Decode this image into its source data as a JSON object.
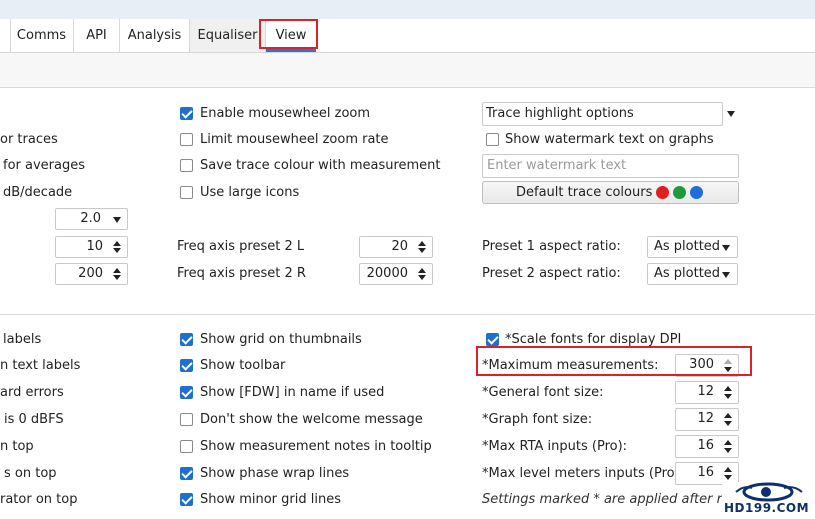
{
  "tabs": [
    {
      "label": "Comms"
    },
    {
      "label": "API"
    },
    {
      "label": "Analysis"
    },
    {
      "label": "Equaliser"
    },
    {
      "label": "View"
    }
  ],
  "left_labels": [
    "or traces",
    "for averages",
    "dB/decade",
    "labels",
    "n text labels",
    "ard errors",
    "is 0 dBFS",
    "n top",
    "s on top",
    "rator on top"
  ],
  "middle_checkboxes_top": [
    {
      "label": "Enable mousewheel zoom",
      "checked": true
    },
    {
      "label": "Limit mousewheel zoom rate",
      "checked": false
    },
    {
      "label": "Save trace colour with measurement",
      "checked": false
    },
    {
      "label": "Use large icons",
      "checked": false
    }
  ],
  "left_controls": {
    "line_width_value": "2.0",
    "spin1_value": "10",
    "spin2_value": "200"
  },
  "freq_presets": [
    {
      "label": "Freq axis preset 2 L",
      "value": "20"
    },
    {
      "label": "Freq axis preset 2 R",
      "value": "20000"
    }
  ],
  "right_top": {
    "trace_highlight_label": "Trace highlight options",
    "watermark_checkbox": {
      "label": "Show watermark text on graphs",
      "checked": false
    },
    "watermark_placeholder": "Enter watermark text",
    "default_colours_label": "Default trace colours",
    "colour_dots": [
      "#e02020",
      "#1f9a3a",
      "#1e6fd9"
    ],
    "aspect_rows": [
      {
        "label": "Preset 1 aspect ratio:",
        "value": "As plotted"
      },
      {
        "label": "Preset 2 aspect ratio:",
        "value": "As plotted"
      }
    ]
  },
  "middle_checkboxes_bottom": [
    {
      "label": "Show grid on thumbnails",
      "checked": true
    },
    {
      "label": "Show toolbar",
      "checked": true
    },
    {
      "label": "Show [FDW] in name if used",
      "checked": true
    },
    {
      "label": "Don't show the welcome message",
      "checked": false
    },
    {
      "label": "Show measurement notes in tooltip",
      "checked": false
    },
    {
      "label": "Show phase wrap lines",
      "checked": true
    },
    {
      "label": "Show minor grid lines",
      "checked": true
    }
  ],
  "right_bottom": {
    "scale_fonts": {
      "label": "*Scale fonts for display DPI",
      "checked": true
    },
    "spinners": [
      {
        "label": "*Maximum measurements:",
        "value": "300"
      },
      {
        "label": "*General font size:",
        "value": "12"
      },
      {
        "label": "*Graph font size:",
        "value": "12"
      },
      {
        "label": "*Max RTA inputs (Pro):",
        "value": "16"
      },
      {
        "label": "*Max level meters inputs (Pro):",
        "value": "16"
      }
    ],
    "restart_note": "Settings marked * are applied after restart"
  },
  "watermark_logo": {
    "text": "HD199.COM"
  },
  "colors": {
    "accent": "#1e6fcf",
    "highlight_box": "#d9232a",
    "tab_underline": "#2e72d2"
  }
}
